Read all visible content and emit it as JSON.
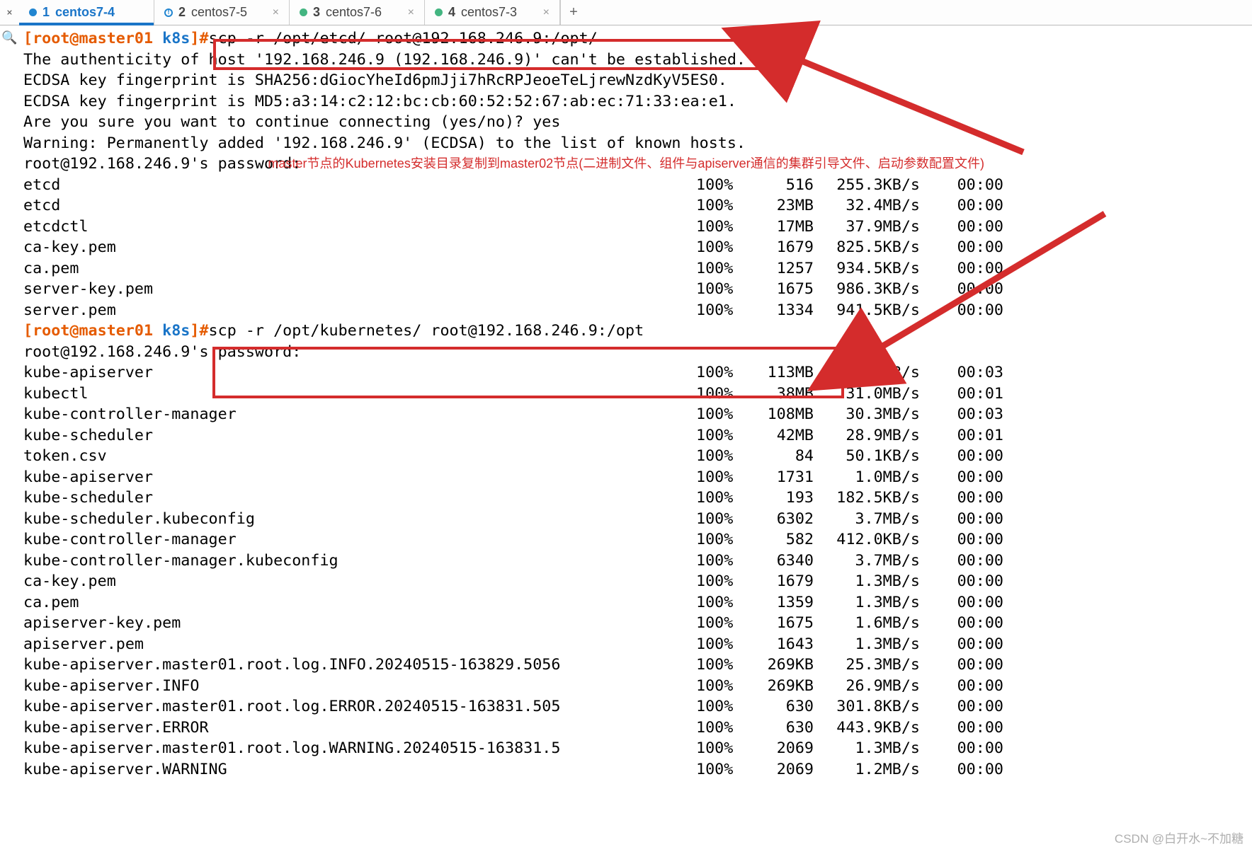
{
  "tabs": [
    {
      "num": "1",
      "label": "centos7-4",
      "status": "blue",
      "active": true
    },
    {
      "num": "2",
      "label": "centos7-5",
      "status": "warn",
      "active": false
    },
    {
      "num": "3",
      "label": "centos7-6",
      "status": "green",
      "active": false
    },
    {
      "num": "4",
      "label": "centos7-3",
      "status": "green",
      "active": false
    }
  ],
  "tab_add": "+",
  "tab_close": "×",
  "prompt": {
    "left": "[root@master01 ",
    "cwd": "k8s",
    "right": "]#"
  },
  "cmd1": "scp -r /opt/etcd/ root@192.168.246.9:/opt/",
  "cmd2": "scp -r /opt/kubernetes/ root@192.168.246.9:/opt",
  "annotation": "master节点的Kubernetes安装目录复制到master02节点(二进制文件、组件与apiserver通信的集群引导文件、启动参数配置文件)",
  "lines_pre": [
    "The authenticity of host '192.168.246.9 (192.168.246.9)' can't be established.",
    "ECDSA key fingerprint is SHA256:dGiocYheId6pmJji7hRcRPJeoeTeLjrewNzdKyV5ES0.",
    "ECDSA key fingerprint is MD5:a3:14:c2:12:bc:cb:60:52:52:67:ab:ec:71:33:ea:e1.",
    "Are you sure you want to continue connecting (yes/no)? yes",
    "Warning: Permanently added '192.168.246.9' (ECDSA) to the list of known hosts.",
    "root@192.168.246.9's password: "
  ],
  "transfers1": [
    {
      "name": "etcd",
      "pct": "100%",
      "size": "516",
      "rate": "255.3KB/s",
      "time": "00:00"
    },
    {
      "name": "etcd",
      "pct": "100%",
      "size": "23MB",
      "rate": "32.4MB/s",
      "time": "00:00"
    },
    {
      "name": "etcdctl",
      "pct": "100%",
      "size": "17MB",
      "rate": "37.9MB/s",
      "time": "00:00"
    },
    {
      "name": "ca-key.pem",
      "pct": "100%",
      "size": "1679",
      "rate": "825.5KB/s",
      "time": "00:00"
    },
    {
      "name": "ca.pem",
      "pct": "100%",
      "size": "1257",
      "rate": "934.5KB/s",
      "time": "00:00"
    },
    {
      "name": "server-key.pem",
      "pct": "100%",
      "size": "1675",
      "rate": "986.3KB/s",
      "time": "00:00"
    },
    {
      "name": "server.pem",
      "pct": "100%",
      "size": "1334",
      "rate": "941.5KB/s",
      "time": "00:00"
    }
  ],
  "passprompt": "root@192.168.246.9's password: ",
  "transfers2": [
    {
      "name": "kube-apiserver",
      "pct": "100%",
      "size": "113MB",
      "rate": "32.0MB/s",
      "time": "00:03"
    },
    {
      "name": "kubectl",
      "pct": "100%",
      "size": "38MB",
      "rate": "31.0MB/s",
      "time": "00:01"
    },
    {
      "name": "kube-controller-manager",
      "pct": "100%",
      "size": "108MB",
      "rate": "30.3MB/s",
      "time": "00:03"
    },
    {
      "name": "kube-scheduler",
      "pct": "100%",
      "size": "42MB",
      "rate": "28.9MB/s",
      "time": "00:01"
    },
    {
      "name": "token.csv",
      "pct": "100%",
      "size": "84",
      "rate": "50.1KB/s",
      "time": "00:00"
    },
    {
      "name": "kube-apiserver",
      "pct": "100%",
      "size": "1731",
      "rate": "1.0MB/s",
      "time": "00:00"
    },
    {
      "name": "kube-scheduler",
      "pct": "100%",
      "size": "193",
      "rate": "182.5KB/s",
      "time": "00:00"
    },
    {
      "name": "kube-scheduler.kubeconfig",
      "pct": "100%",
      "size": "6302",
      "rate": "3.7MB/s",
      "time": "00:00"
    },
    {
      "name": "kube-controller-manager",
      "pct": "100%",
      "size": "582",
      "rate": "412.0KB/s",
      "time": "00:00"
    },
    {
      "name": "kube-controller-manager.kubeconfig",
      "pct": "100%",
      "size": "6340",
      "rate": "3.7MB/s",
      "time": "00:00"
    },
    {
      "name": "ca-key.pem",
      "pct": "100%",
      "size": "1679",
      "rate": "1.3MB/s",
      "time": "00:00"
    },
    {
      "name": "ca.pem",
      "pct": "100%",
      "size": "1359",
      "rate": "1.3MB/s",
      "time": "00:00"
    },
    {
      "name": "apiserver-key.pem",
      "pct": "100%",
      "size": "1675",
      "rate": "1.6MB/s",
      "time": "00:00"
    },
    {
      "name": "apiserver.pem",
      "pct": "100%",
      "size": "1643",
      "rate": "1.3MB/s",
      "time": "00:00"
    },
    {
      "name": "kube-apiserver.master01.root.log.INFO.20240515-163829.5056",
      "pct": "100%",
      "size": "269KB",
      "rate": "25.3MB/s",
      "time": "00:00"
    },
    {
      "name": "kube-apiserver.INFO",
      "pct": "100%",
      "size": "269KB",
      "rate": "26.9MB/s",
      "time": "00:00"
    },
    {
      "name": "kube-apiserver.master01.root.log.ERROR.20240515-163831.505",
      "pct": "100%",
      "size": "630",
      "rate": "301.8KB/s",
      "time": "00:00"
    },
    {
      "name": "kube-apiserver.ERROR",
      "pct": "100%",
      "size": "630",
      "rate": "443.9KB/s",
      "time": "00:00"
    },
    {
      "name": "kube-apiserver.master01.root.log.WARNING.20240515-163831.5",
      "pct": "100%",
      "size": "2069",
      "rate": "1.3MB/s",
      "time": "00:00"
    },
    {
      "name": "kube-apiserver.WARNING",
      "pct": "100%",
      "size": "2069",
      "rate": "1.2MB/s",
      "time": "00:00"
    }
  ],
  "watermark": "CSDN @白开水~不加糖"
}
